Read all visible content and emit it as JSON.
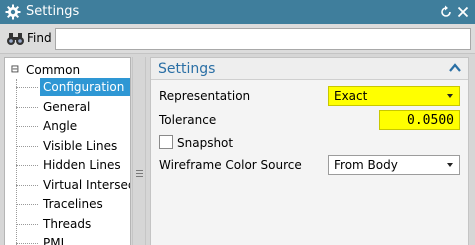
{
  "window": {
    "title": "Settings",
    "title_bar_color": "#3f7e9c",
    "icons": [
      "gear-icon",
      "reset-icon",
      "close-icon"
    ]
  },
  "find": {
    "label": "Find",
    "value": ""
  },
  "tree": {
    "root": {
      "label": "Common",
      "expanded": true
    },
    "items": [
      {
        "label": "Configuration",
        "selected": true
      },
      {
        "label": "General"
      },
      {
        "label": "Angle"
      },
      {
        "label": "Visible Lines"
      },
      {
        "label": "Hidden Lines"
      },
      {
        "label": "Virtual Intersections"
      },
      {
        "label": "Tracelines"
      },
      {
        "label": "Threads"
      },
      {
        "label": "PMI"
      }
    ],
    "selection_color": "#2e97d4"
  },
  "panel": {
    "title": "Settings",
    "title_color": "#2a6fa5",
    "representation": {
      "label": "Representation",
      "value": "Exact",
      "highlight_color": "#ffff00"
    },
    "tolerance": {
      "label": "Tolerance",
      "value": "0.0500",
      "highlight_color": "#ffff00"
    },
    "snapshot": {
      "label": "Snapshot",
      "checked": false
    },
    "wireframe_color_source": {
      "label": "Wireframe Color Source",
      "value": "From Body"
    }
  }
}
